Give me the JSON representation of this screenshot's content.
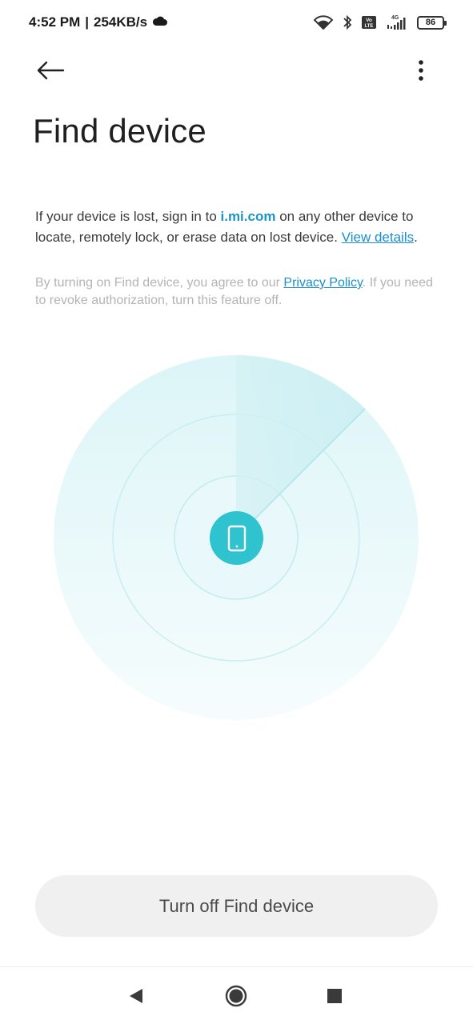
{
  "status_bar": {
    "time": "4:52 PM",
    "separator": "|",
    "speed": "254KB/s",
    "network_type": "4G",
    "volte_label": "Vo LTE",
    "battery": "86",
    "icons": [
      "cloud-icon",
      "wifi-icon",
      "bluetooth-icon",
      "volte-icon",
      "signal-icon",
      "battery-icon"
    ]
  },
  "toolbar": {
    "back_icon": "arrow-left-icon",
    "more_icon": "more-vertical-icon"
  },
  "page": {
    "title": "Find device"
  },
  "description": {
    "part1": "If your device is lost, sign in to ",
    "site": "i.mi.com",
    "part2": " on any other device to locate, remotely lock, or erase data on lost device. ",
    "link": "View details",
    "part3": "."
  },
  "notice": {
    "part1": "By turning on Find device, you agree to our ",
    "link": "Privacy Policy",
    "part2": ". If you need to revoke authorization, turn this feature off."
  },
  "radar": {
    "center_icon": "phone-icon",
    "accent_color": "#2fc2cf"
  },
  "actions": {
    "turn_off_label": "Turn off Find device"
  },
  "nav_bar": {
    "icons": [
      "back-triangle-icon",
      "home-circle-icon",
      "recents-square-icon"
    ]
  }
}
